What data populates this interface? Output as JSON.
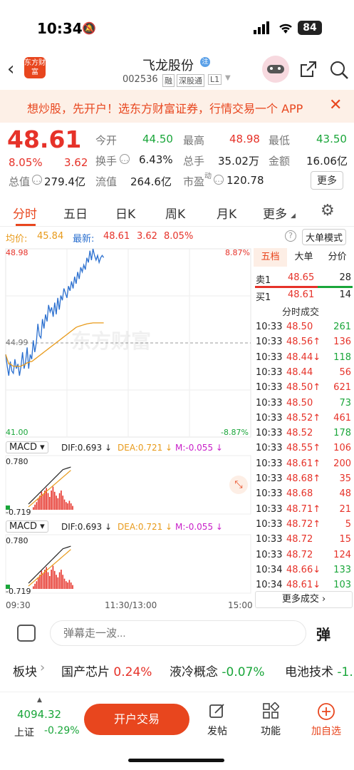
{
  "status": {
    "time": "10:34",
    "battery": "84"
  },
  "nav": {
    "title": "飞龙股份",
    "code": "002536",
    "tag1": "融",
    "tag2": "深股通",
    "tag3": "L1",
    "logo_text": "东方财富"
  },
  "banner": {
    "text": "想炒股，先开户！选东方财富证券，行情交易一个 APP"
  },
  "quote": {
    "price": "48.61",
    "pct": "8.05%",
    "change": "3.62",
    "open_label": "今开",
    "open": "44.50",
    "high_label": "最高",
    "high": "48.98",
    "low_label": "最低",
    "low": "43.50",
    "turnover_label": "换手",
    "turnover": "6.43%",
    "volume_label": "总手",
    "volume": "35.02万",
    "amount_label": "金额",
    "amount": "16.06亿",
    "mcap_label": "总值",
    "mcap": "279.4亿",
    "float_label": "流值",
    "float": "264.6亿",
    "pe_label": "市盈",
    "pe_sup": "动",
    "pe": "120.78",
    "more": "更多"
  },
  "tabs": [
    "分时",
    "五日",
    "日K",
    "周K",
    "月K",
    "更多"
  ],
  "chartinfo": {
    "avg_label": "均价:",
    "avg": "45.84",
    "last_label": "最新:",
    "last": "48.61",
    "chg": "3.62",
    "pct": "8.05%",
    "mode": "大单模式"
  },
  "chart": {
    "top_price": "48.98",
    "top_pct": "8.87%",
    "mid_price": "44.99",
    "bot_price": "41.00",
    "bot_pct": "-8.87%",
    "watermark": "东方财富",
    "macd1": {
      "label": "MACD",
      "dif": "DIF:0.693 ↓",
      "dea": "DEA:0.721 ↓",
      "m": "M:-0.055 ↓",
      "top": "0.780",
      "bot": "-0.719"
    },
    "macd2": {
      "label": "MACD",
      "dif": "DIF:0.693 ↓",
      "dea": "DEA:0.721 ↓",
      "m": "M:-0.055 ↓",
      "top": "0.780",
      "bot": "-0.719"
    },
    "time_start": "09:30",
    "time_mid": "11:30/13:00",
    "time_end": "15:00"
  },
  "chart_data": {
    "type": "line",
    "x": [
      "09:30",
      "09:31",
      "09:32",
      "09:33",
      "09:34",
      "09:35",
      "09:36",
      "09:37",
      "09:38",
      "09:39",
      "09:40",
      "09:41",
      "09:42",
      "09:43",
      "09:44",
      "09:45",
      "09:46",
      "09:47",
      "09:48",
      "09:49",
      "09:50",
      "09:51",
      "09:52",
      "09:53",
      "09:54",
      "09:55",
      "09:56",
      "09:57",
      "09:58",
      "09:59",
      "10:00",
      "10:01",
      "10:02",
      "10:03",
      "10:04",
      "10:05",
      "10:06",
      "10:07",
      "10:08",
      "10:09",
      "10:10",
      "10:11",
      "10:12",
      "10:13",
      "10:14",
      "10:15",
      "10:16",
      "10:17",
      "10:18",
      "10:19",
      "10:20",
      "10:21",
      "10:22",
      "10:23",
      "10:24",
      "10:25",
      "10:26",
      "10:27",
      "10:28",
      "10:29",
      "10:30",
      "10:31",
      "10:32",
      "10:33",
      "10:34"
    ],
    "series": [
      {
        "name": "最新",
        "values": [
          44.5,
          44.0,
          43.6,
          44.2,
          43.8,
          43.7,
          44.3,
          43.9,
          44.1,
          43.6,
          44.0,
          44.6,
          43.9,
          44.2,
          44.8,
          43.9,
          44.5,
          44.3,
          45.1,
          44.6,
          45.0,
          45.8,
          45.3,
          45.2,
          46.0,
          45.6,
          46.2,
          45.9,
          46.6,
          46.3,
          46.5,
          46.1,
          46.7,
          46.2,
          46.9,
          46.4,
          47.0,
          46.8,
          47.3,
          47.1,
          46.9,
          47.4,
          47.2,
          47.6,
          47.3,
          47.8,
          47.5,
          48.0,
          47.7,
          48.2,
          48.0,
          48.3,
          48.1,
          48.6,
          48.4,
          48.9,
          48.5,
          48.98,
          48.7,
          48.5,
          48.7,
          48.4,
          48.6,
          48.7,
          48.61
        ]
      },
      {
        "name": "均价",
        "values": [
          44.5,
          44.3,
          44.1,
          44.1,
          44.05,
          44.0,
          44.0,
          44.0,
          44.0,
          44.0,
          44.0,
          44.05,
          44.05,
          44.1,
          44.15,
          44.15,
          44.2,
          44.2,
          44.25,
          44.3,
          44.35,
          44.4,
          44.45,
          44.5,
          44.55,
          44.6,
          44.65,
          44.7,
          44.75,
          44.8,
          44.85,
          44.9,
          44.95,
          45.0,
          45.05,
          45.1,
          45.15,
          45.2,
          45.25,
          45.3,
          45.35,
          45.4,
          45.45,
          45.5,
          45.55,
          45.6,
          45.65,
          45.68,
          45.7,
          45.72,
          45.74,
          45.76,
          45.78,
          45.8,
          45.81,
          45.82,
          45.83,
          45.84,
          45.84,
          45.84,
          45.84,
          45.84,
          45.84,
          45.84,
          45.84
        ]
      }
    ],
    "ylim": [
      41.0,
      48.98
    ],
    "prev_close": 44.99
  },
  "book": {
    "tabs": [
      "五档",
      "大单",
      "分价"
    ],
    "sell1": {
      "label": "卖1",
      "price": "48.65",
      "vol": "28"
    },
    "buy1": {
      "label": "买1",
      "price": "48.61",
      "vol": "14"
    },
    "ticks_title": "分时成交",
    "ticks": [
      {
        "t": "10:33",
        "p": "48.50",
        "a": "",
        "v": "261",
        "c": "green"
      },
      {
        "t": "10:33",
        "p": "48.56",
        "a": "↑",
        "v": "136",
        "c": "red"
      },
      {
        "t": "10:33",
        "p": "48.44",
        "a": "↓",
        "v": "118",
        "c": "green"
      },
      {
        "t": "10:33",
        "p": "48.44",
        "a": "",
        "v": "56",
        "c": "red"
      },
      {
        "t": "10:33",
        "p": "48.50",
        "a": "↑",
        "v": "621",
        "c": "red"
      },
      {
        "t": "10:33",
        "p": "48.50",
        "a": "",
        "v": "73",
        "c": "green"
      },
      {
        "t": "10:33",
        "p": "48.52",
        "a": "↑",
        "v": "461",
        "c": "red"
      },
      {
        "t": "10:33",
        "p": "48.52",
        "a": "",
        "v": "178",
        "c": "green"
      },
      {
        "t": "10:33",
        "p": "48.55",
        "a": "↑",
        "v": "106",
        "c": "red"
      },
      {
        "t": "10:33",
        "p": "48.61",
        "a": "↑",
        "v": "200",
        "c": "red"
      },
      {
        "t": "10:33",
        "p": "48.68",
        "a": "↑",
        "v": "35",
        "c": "red"
      },
      {
        "t": "10:33",
        "p": "48.68",
        "a": "",
        "v": "48",
        "c": "red"
      },
      {
        "t": "10:33",
        "p": "48.71",
        "a": "↑",
        "v": "21",
        "c": "red"
      },
      {
        "t": "10:33",
        "p": "48.72",
        "a": "↑",
        "v": "5",
        "c": "red"
      },
      {
        "t": "10:33",
        "p": "48.72",
        "a": "",
        "v": "15",
        "c": "red"
      },
      {
        "t": "10:33",
        "p": "48.72",
        "a": "",
        "v": "124",
        "c": "red"
      },
      {
        "t": "10:34",
        "p": "48.66",
        "a": "↓",
        "v": "133",
        "c": "green"
      },
      {
        "t": "10:34",
        "p": "48.61",
        "a": "↓",
        "v": "103",
        "c": "green"
      }
    ],
    "more": "更多成交"
  },
  "comment": {
    "placeholder": "弹幕走一波...",
    "danmu": "弹"
  },
  "sectors": {
    "label": "板块",
    "items": [
      {
        "name": "国产芯片",
        "pct": "0.24%",
        "c": "red"
      },
      {
        "name": "液冷概念",
        "pct": "-0.07%",
        "c": "green"
      },
      {
        "name": "电池技术",
        "pct": "-1.",
        "c": "green"
      }
    ]
  },
  "bottom": {
    "index_value": "4094.32",
    "index_name": "上证",
    "index_pct": "-0.29%",
    "open_btn": "开户交易",
    "post": "发帖",
    "func": "功能",
    "add": "加自选",
    "watermark": "@"
  }
}
